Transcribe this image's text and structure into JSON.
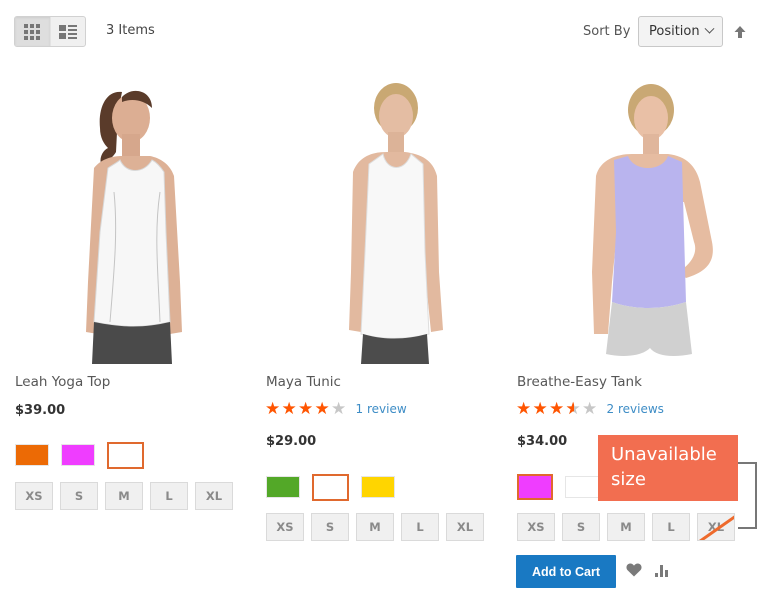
{
  "toolbar": {
    "view_modes": [
      {
        "name": "grid",
        "icon": "grid-icon",
        "active": true
      },
      {
        "name": "list",
        "icon": "list-icon",
        "active": false
      }
    ],
    "items_count": "3 Items",
    "sort_label": "Sort By",
    "sort_value": "Position",
    "sort_direction_icon": "arrow-up-icon"
  },
  "products": [
    {
      "name": "Leah Yoga Top",
      "price": "$39.00",
      "rating": null,
      "reviews": null,
      "shirt_color": "#f7f7f7",
      "swatches": [
        {
          "color": "#ec6a05",
          "selected": false
        },
        {
          "color": "#ef3dff",
          "selected": false
        },
        {
          "color": "#ffffff",
          "selected": true
        }
      ],
      "sizes": [
        "XS",
        "S",
        "M",
        "L",
        "XL"
      ]
    },
    {
      "name": "Maya Tunic",
      "price": "$29.00",
      "rating": 4,
      "reviews": "1 review",
      "shirt_color": "#f8f8f8",
      "swatches": [
        {
          "color": "#53a828",
          "selected": false
        },
        {
          "color": "#ffffff",
          "selected": true
        },
        {
          "color": "#ffd500",
          "selected": false
        }
      ],
      "sizes": [
        "XS",
        "S",
        "M",
        "L",
        "XL"
      ]
    },
    {
      "name": "Breathe-Easy Tank",
      "price": "$34.00",
      "rating": 3.5,
      "reviews": "2 reviews",
      "shirt_color": "#b9b4ee",
      "swatches": [
        {
          "color": "#ef3dff",
          "selected": true
        },
        {
          "color": "#ffffff",
          "selected": false
        },
        {
          "color": "#ffd500",
          "selected": false
        }
      ],
      "sizes": [
        "XS",
        "S",
        "M",
        "L",
        "XL"
      ],
      "unavailable_sizes": [
        "XL"
      ],
      "add_to_cart": "Add to Cart",
      "wishlist_icon": "heart-icon",
      "compare_icon": "compare-icon"
    }
  ],
  "callout": {
    "line1": "Unavailable",
    "line2": "size",
    "color": "#f26e50"
  },
  "colors": {
    "accent_orange": "#ff5501",
    "primary_button": "#1979c3",
    "link": "#3e8dc6"
  }
}
